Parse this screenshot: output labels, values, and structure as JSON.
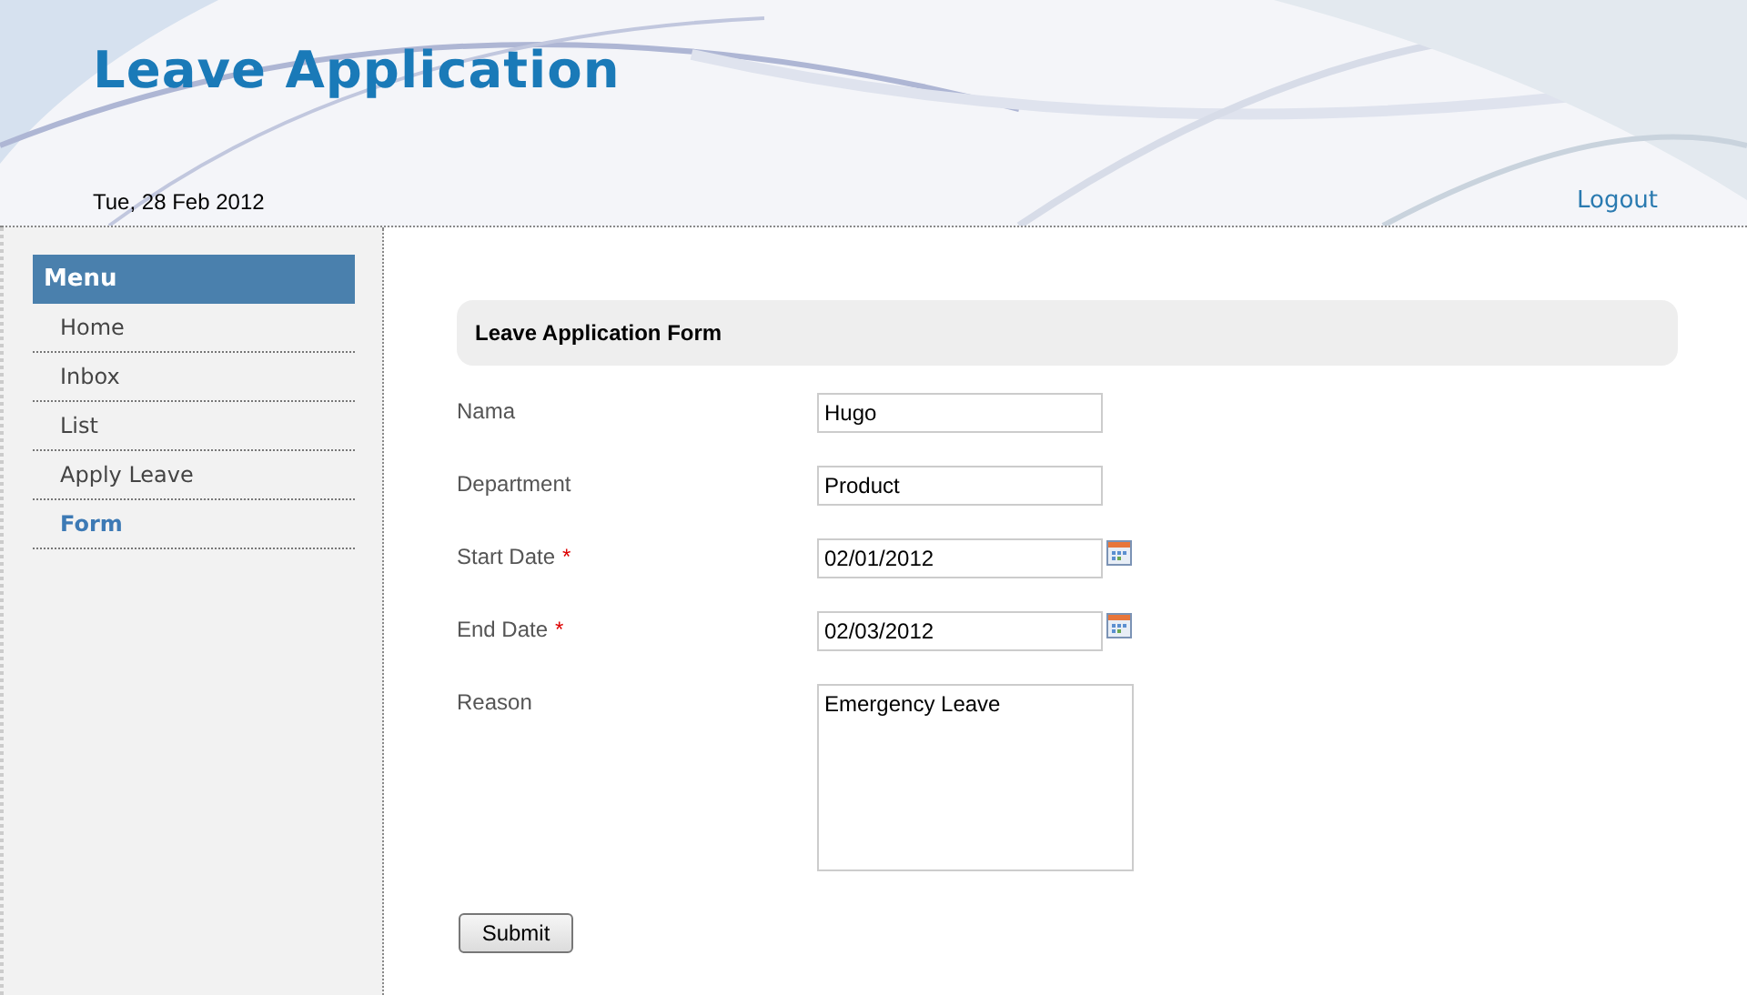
{
  "header": {
    "title": "Leave Application",
    "date": "Tue, 28 Feb 2012",
    "logout": "Logout"
  },
  "menu": {
    "title": "Menu",
    "items": [
      {
        "label": "Home",
        "selected": false
      },
      {
        "label": "Inbox",
        "selected": false
      },
      {
        "label": "List",
        "selected": false
      },
      {
        "label": "Apply Leave",
        "selected": false
      },
      {
        "label": "Form",
        "selected": true
      }
    ]
  },
  "form": {
    "title": "Leave Application Form",
    "fields": [
      {
        "kind": "text",
        "label": "Nama",
        "required": false,
        "value": "Hugo"
      },
      {
        "kind": "text",
        "label": "Department",
        "required": false,
        "value": "Product"
      },
      {
        "kind": "date",
        "label": "Start Date",
        "required": true,
        "value": "02/01/2012"
      },
      {
        "kind": "date",
        "label": "End Date",
        "required": true,
        "value": "02/03/2012"
      },
      {
        "kind": "textarea",
        "label": "Reason",
        "required": false,
        "value": "Emergency Leave"
      }
    ],
    "required_mark": "*",
    "submit": "Submit"
  }
}
